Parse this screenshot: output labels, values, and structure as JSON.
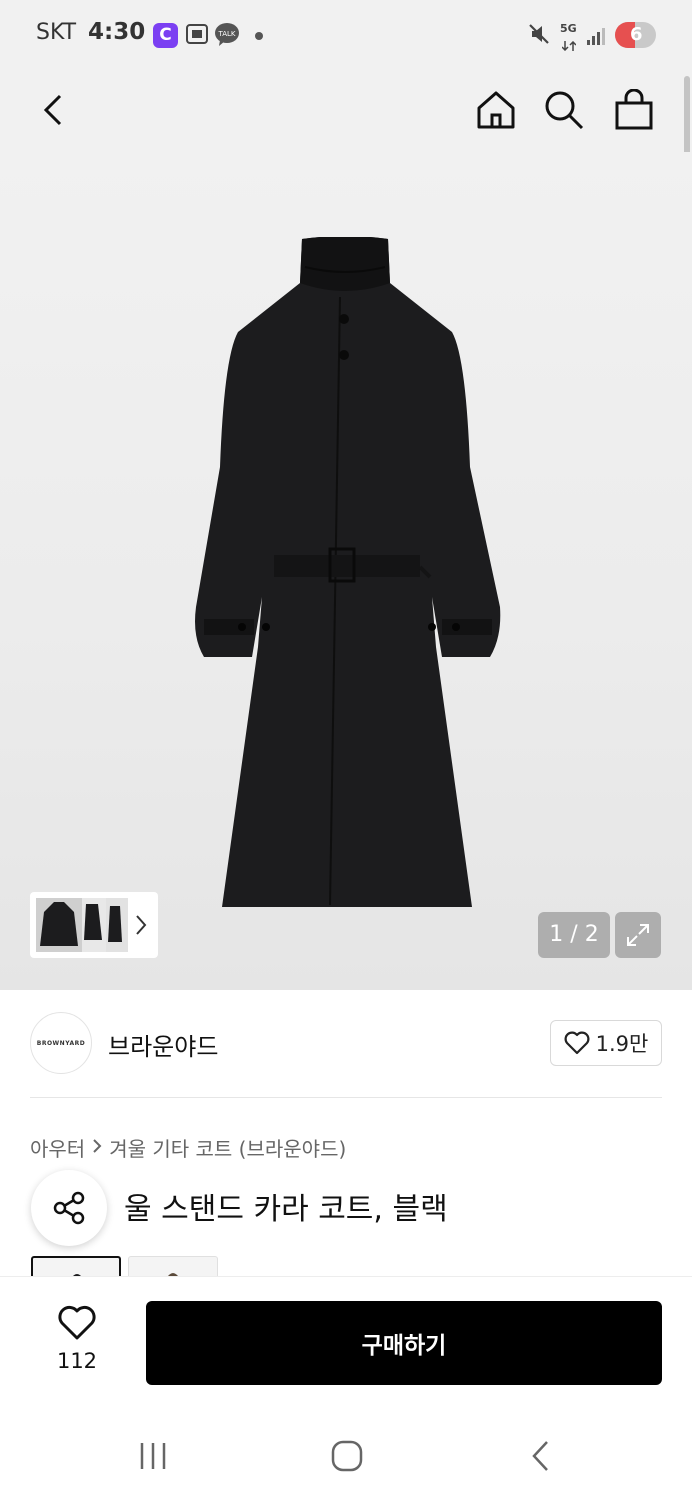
{
  "status_bar": {
    "carrier": "SKT",
    "time": "4:30",
    "app_badge": "C",
    "talk_label": "TALK",
    "network": "5G",
    "battery": "6",
    "battery_color": "#e65050"
  },
  "top_nav": {
    "back_icon": "chevron-left-icon",
    "home_icon": "home-icon",
    "search_icon": "search-icon",
    "cart_icon": "shopping-bag-icon"
  },
  "gallery": {
    "counter": "1 / 2",
    "expand_icon": "expand-icon",
    "thumb_next_icon": "chevron-right-icon"
  },
  "brand": {
    "logo_text": "BROWNYARD",
    "name": "브라운야드",
    "like_count": "1.9만"
  },
  "breadcrumb": {
    "items": [
      "아우터",
      "겨울 기타 코트 (브라운야드)"
    ]
  },
  "product": {
    "title_visible": "울 스탠드 카라 코트, 블랙"
  },
  "purchase_bar": {
    "wish_count": "112",
    "buy_label": "구매하기",
    "accent": "#000000"
  },
  "system_nav": {
    "recent_icon": "recent-apps-icon",
    "home_icon": "home-button-icon",
    "back_icon": "back-icon"
  }
}
